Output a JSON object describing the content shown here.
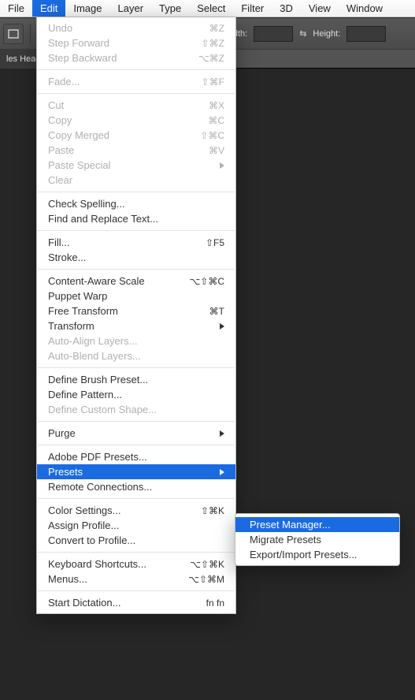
{
  "menubar": {
    "items": [
      "File",
      "Edit",
      "Image",
      "Layer",
      "Type",
      "Select",
      "Filter",
      "3D",
      "View",
      "Window"
    ],
    "active_index": 1
  },
  "toolbar": {
    "width_label": "Width:",
    "height_label": "Height:",
    "doc_tab": "les Heade"
  },
  "edit_menu": {
    "groups": [
      [
        {
          "label": "Undo",
          "acc": "⌘Z",
          "disabled": true
        },
        {
          "label": "Step Forward",
          "acc": "⇧⌘Z",
          "disabled": true
        },
        {
          "label": "Step Backward",
          "acc": "⌥⌘Z",
          "disabled": true
        }
      ],
      [
        {
          "label": "Fade...",
          "acc": "⇧⌘F",
          "disabled": true
        }
      ],
      [
        {
          "label": "Cut",
          "acc": "⌘X",
          "disabled": true
        },
        {
          "label": "Copy",
          "acc": "⌘C",
          "disabled": true
        },
        {
          "label": "Copy Merged",
          "acc": "⇧⌘C",
          "disabled": true
        },
        {
          "label": "Paste",
          "acc": "⌘V",
          "disabled": true
        },
        {
          "label": "Paste Special",
          "submenu": true,
          "disabled": true
        },
        {
          "label": "Clear",
          "disabled": true
        }
      ],
      [
        {
          "label": "Check Spelling..."
        },
        {
          "label": "Find and Replace Text..."
        }
      ],
      [
        {
          "label": "Fill...",
          "acc": "⇧F5"
        },
        {
          "label": "Stroke..."
        }
      ],
      [
        {
          "label": "Content-Aware Scale",
          "acc": "⌥⇧⌘C"
        },
        {
          "label": "Puppet Warp"
        },
        {
          "label": "Free Transform",
          "acc": "⌘T"
        },
        {
          "label": "Transform",
          "submenu": true
        },
        {
          "label": "Auto-Align Layers...",
          "disabled": true
        },
        {
          "label": "Auto-Blend Layers...",
          "disabled": true
        }
      ],
      [
        {
          "label": "Define Brush Preset..."
        },
        {
          "label": "Define Pattern..."
        },
        {
          "label": "Define Custom Shape...",
          "disabled": true
        }
      ],
      [
        {
          "label": "Purge",
          "submenu": true
        }
      ],
      [
        {
          "label": "Adobe PDF Presets..."
        },
        {
          "label": "Presets",
          "submenu": true,
          "highlight": true
        },
        {
          "label": "Remote Connections..."
        }
      ],
      [
        {
          "label": "Color Settings...",
          "acc": "⇧⌘K"
        },
        {
          "label": "Assign Profile..."
        },
        {
          "label": "Convert to Profile..."
        }
      ],
      [
        {
          "label": "Keyboard Shortcuts...",
          "acc": "⌥⇧⌘K"
        },
        {
          "label": "Menus...",
          "acc": "⌥⇧⌘M"
        }
      ],
      [
        {
          "label": "Start Dictation...",
          "acc": "fn fn"
        }
      ]
    ]
  },
  "presets_submenu": {
    "items": [
      {
        "label": "Preset Manager...",
        "highlight": true
      },
      {
        "label": "Migrate Presets"
      },
      {
        "label": "Export/Import Presets..."
      }
    ]
  }
}
